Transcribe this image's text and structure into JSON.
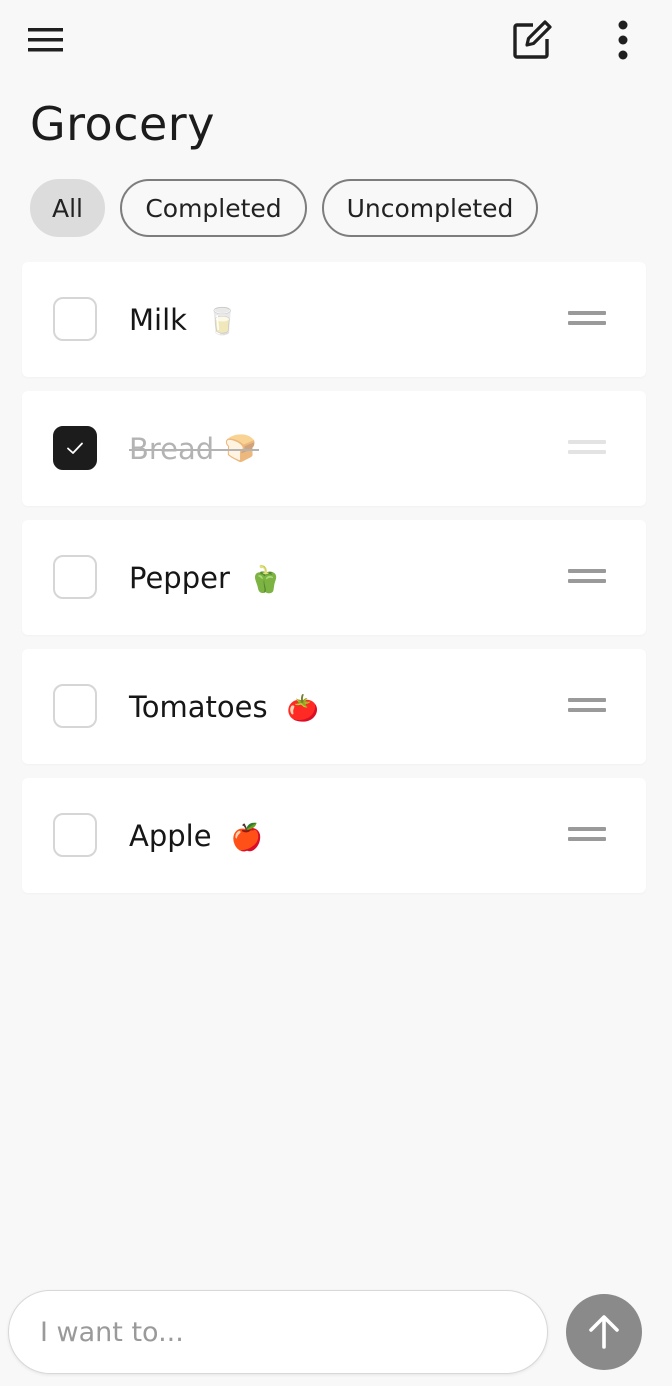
{
  "header": {
    "title": "Grocery",
    "menu_icon": "hamburger-menu-icon",
    "edit_icon": "edit-note-icon",
    "more_icon": "more-vertical-icon"
  },
  "filters": {
    "selected": "All",
    "chips": [
      {
        "label": "All",
        "active": true
      },
      {
        "label": "Completed",
        "active": false
      },
      {
        "label": "Uncompleted",
        "active": false
      }
    ]
  },
  "items": [
    {
      "label": "Milk",
      "emoji": "🥛",
      "completed": false
    },
    {
      "label": "Bread",
      "emoji": "🍞",
      "completed": true
    },
    {
      "label": "Pepper",
      "emoji": "🫑",
      "completed": false
    },
    {
      "label": "Tomatoes",
      "emoji": "🍅",
      "completed": false
    },
    {
      "label": "Apple",
      "emoji": "🍎",
      "completed": false
    }
  ],
  "composer": {
    "placeholder": "I want to...",
    "value": "",
    "send_icon": "arrow-up-icon"
  },
  "colors": {
    "background": "#f8f8f8",
    "card": "#ffffff",
    "checked": "#1c1c1c",
    "active_chip": "#dcdcdc",
    "send_button": "#8a8a8a"
  }
}
